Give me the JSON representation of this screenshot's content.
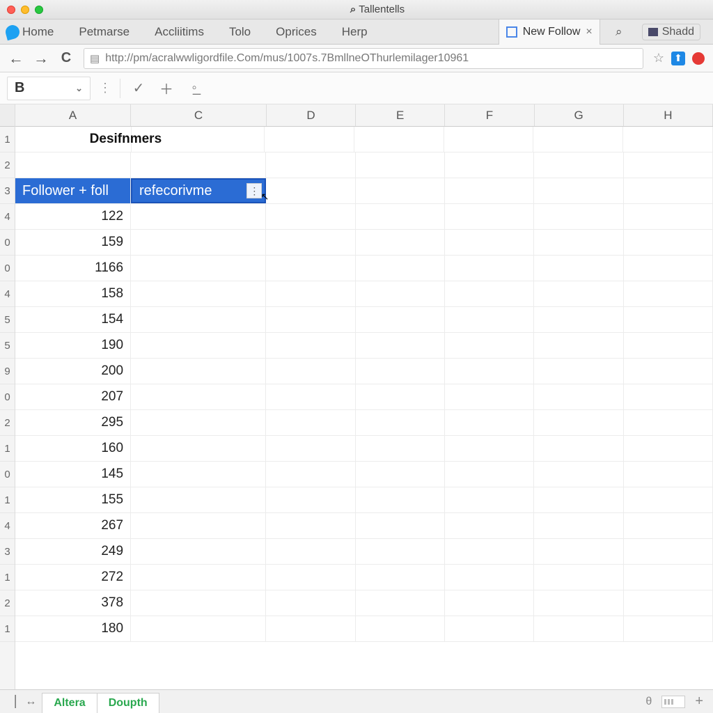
{
  "window_title": "Tallentells",
  "bookmarks": [
    "Home",
    "Petmarse",
    "Accliitims",
    "Tolo",
    "Oprices",
    "Herp"
  ],
  "active_tab": {
    "label": "New Follow"
  },
  "overflow_tab": "Shadd",
  "url": "http://pm/acralwwligordfile.Com/mus/1007s.7BmllneOThurlemilager10961",
  "font_select": "B",
  "columns": [
    "A",
    "C",
    "D",
    "E",
    "F",
    "G",
    "H"
  ],
  "row_labels": [
    "1",
    "2",
    "3",
    "4",
    "0",
    "0",
    "4",
    "5",
    "5",
    "9",
    "0",
    "2",
    "1",
    "0",
    "1",
    "4",
    "3",
    "1",
    "2",
    "1"
  ],
  "title_cell": "Desifnmers",
  "header_row": {
    "A": "Follower + foll",
    "C": "refecorivme"
  },
  "values": [
    122,
    159,
    1166,
    158,
    154,
    190,
    200,
    207,
    295,
    160,
    145,
    155,
    267,
    249,
    272,
    378,
    180
  ],
  "sheet_tabs": [
    "Altera",
    "Doupth"
  ],
  "theta": "θ"
}
